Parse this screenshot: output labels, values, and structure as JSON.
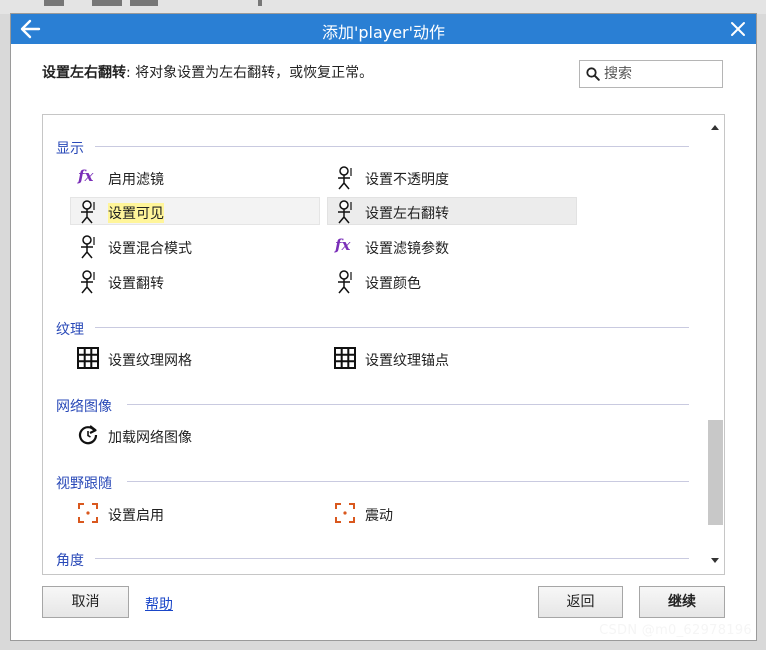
{
  "dialog": {
    "title": "添加'player'动作",
    "action_name": "设置左右翻转",
    "action_desc": ": 将对象设置为左右翻转，或恢复正常。",
    "search_placeholder": "搜索"
  },
  "sections": [
    {
      "title": "显示",
      "items": [
        {
          "label": "启用滤镜",
          "icon": "fx-icon"
        },
        {
          "label": "设置不透明度",
          "icon": "sprite-figure-icon"
        },
        {
          "label": "设置可见",
          "icon": "sprite-figure-icon"
        },
        {
          "label": "设置左右翻转",
          "icon": "sprite-figure-icon"
        },
        {
          "label": "设置混合模式",
          "icon": "sprite-figure-icon"
        },
        {
          "label": "设置滤镜参数",
          "icon": "fx-icon"
        },
        {
          "label": "设置翻转",
          "icon": "sprite-figure-icon"
        },
        {
          "label": "设置颜色",
          "icon": "sprite-figure-icon"
        }
      ]
    },
    {
      "title": "纹理",
      "items": [
        {
          "label": "设置纹理网格",
          "icon": "grid-icon"
        },
        {
          "label": "设置纹理锚点",
          "icon": "grid-icon"
        }
      ]
    },
    {
      "title": "网络图像",
      "items": [
        {
          "label": "加载网络图像",
          "icon": "reload-icon"
        }
      ]
    },
    {
      "title": "视野跟随",
      "items": [
        {
          "label": "设置启用",
          "icon": "focus-frame-icon"
        },
        {
          "label": "震动",
          "icon": "focus-frame-icon"
        }
      ]
    },
    {
      "title": "角度",
      "items": []
    }
  ],
  "buttons": {
    "cancel": "取消",
    "help": "帮助",
    "back": "返回",
    "continue": "继续"
  },
  "watermark": "CSDN @m0_62978196",
  "colors": {
    "titlebar": "#2a7fd4",
    "section_title": "#2a4ab8",
    "fx_icon": "#7a2eb8",
    "focus_icon": "#d9581e",
    "search_highlight": "#fff59a"
  }
}
